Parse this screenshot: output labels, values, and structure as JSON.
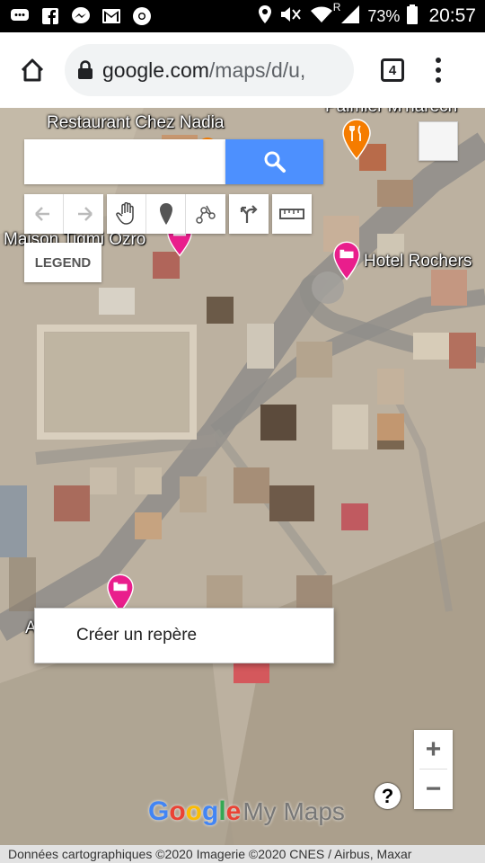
{
  "status_bar": {
    "battery": "73%",
    "time": "20:57",
    "network_letter": "R",
    "icons": [
      "message-icon",
      "facebook-icon",
      "messenger-icon",
      "gmail-icon",
      "chrome-icon",
      "location-icon",
      "mute-icon",
      "wifi-icon",
      "signal-icon",
      "battery-icon"
    ]
  },
  "browser": {
    "url_host": "google.com",
    "url_path": "/maps/d/u,",
    "tab_count": "4"
  },
  "map": {
    "search": {
      "placeholder": "",
      "value": ""
    },
    "legend_label": "LEGEND",
    "places": [
      {
        "name": "Restaurant Chez Nadia"
      },
      {
        "name": "Palmier M'harech"
      },
      {
        "name": "Maison Tigmi Ozro"
      },
      {
        "name": "Hotel Rochers"
      },
      {
        "name": "A"
      }
    ],
    "context_menu": {
      "item_label": "Créer un repère"
    },
    "zoom": {
      "in_label": "+",
      "out_label": "−"
    },
    "help_label": "?",
    "logo": {
      "g1": "G",
      "g2": "o",
      "g3": "o",
      "g4": "g",
      "g5": "l",
      "g6": "e",
      "product": "My Maps"
    },
    "attribution": "Données cartographiques ©2020 Imagerie ©2020 CNES / Airbus, Maxar"
  },
  "colors": {
    "search_button": "#4d90fe",
    "pin_pink": "#e91e8c",
    "pin_orange": "#f57c00"
  }
}
